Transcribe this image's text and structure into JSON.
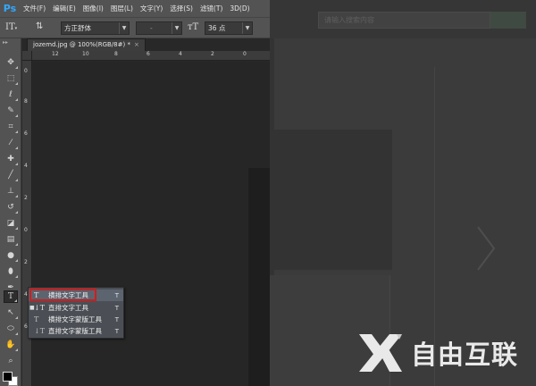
{
  "app": {
    "logo": "Ps"
  },
  "menubar": {
    "items": [
      "文件(F)",
      "编辑(E)",
      "图像(I)",
      "图层(L)",
      "文字(Y)",
      "选择(S)",
      "滤镜(T)",
      "3D(D)"
    ]
  },
  "options": {
    "font_family": "方正舒体",
    "font_style": "-",
    "font_size": "36 点"
  },
  "document": {
    "tab_title": "jozemd.jpg @ 100%(RGB/8#) *",
    "ruler_h": [
      "12",
      "10",
      "8",
      "6",
      "4",
      "2",
      "0"
    ],
    "ruler_v": [
      "0",
      "8",
      "6",
      "4",
      "2",
      "0",
      "2",
      "4",
      "6"
    ]
  },
  "type_tool_menu": {
    "items": [
      {
        "label": "横排文字工具",
        "key": "T",
        "icon": "horizontal-type-icon"
      },
      {
        "label": "直排文字工具",
        "key": "T",
        "icon": "vertical-type-icon"
      },
      {
        "label": "横排文字蒙版工具",
        "key": "T",
        "icon": "horizontal-type-mask-icon"
      },
      {
        "label": "直排文字蒙版工具",
        "key": "T",
        "icon": "vertical-type-mask-icon"
      }
    ]
  },
  "web": {
    "search_placeholder": "请输入搜索内容"
  },
  "watermark": {
    "text": "自由互联"
  },
  "colors": {
    "ps_blue": "#31a8ff",
    "highlight_red": "#d01d1d",
    "foreground": "#000000",
    "background": "#ffffff"
  }
}
